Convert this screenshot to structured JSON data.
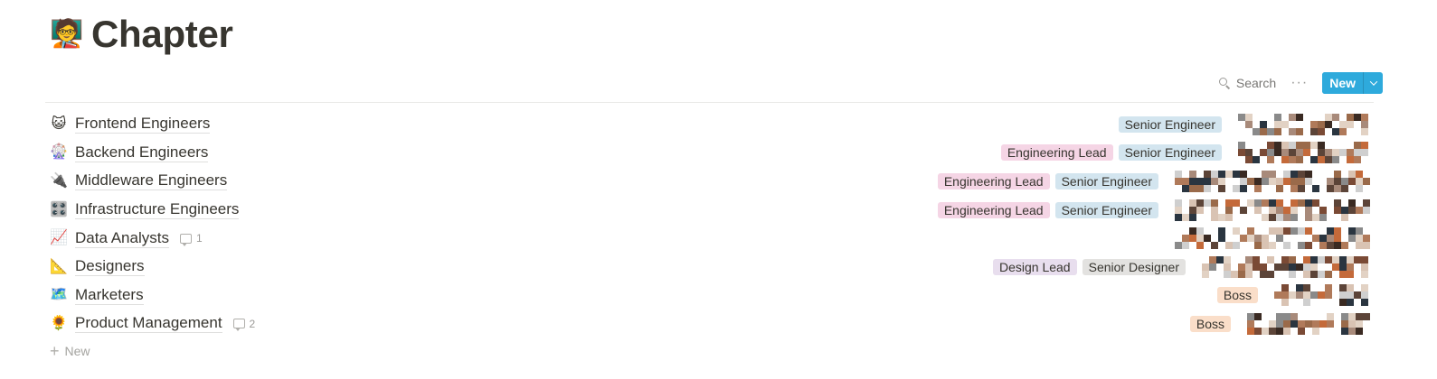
{
  "page": {
    "icon": "🧑‍🏫",
    "title": "Chapter"
  },
  "toolbar": {
    "search_label": "Search",
    "more_label": "···",
    "new_label": "New"
  },
  "colors": {
    "accent": "#2eaadc",
    "tag_pink": "#f5d5e5",
    "tag_blue": "#d3e5ef",
    "tag_purple": "#e8deee",
    "tag_gray": "#e3e2e0",
    "tag_orange": "#fadec9"
  },
  "rows": [
    {
      "icon": "😺",
      "title": "Frontend Engineers",
      "comments": "",
      "tags": [
        {
          "label": "Senior Engineer",
          "color": "blue"
        }
      ]
    },
    {
      "icon": "🎡",
      "title": "Backend Engineers",
      "comments": "",
      "tags": [
        {
          "label": "Engineering Lead",
          "color": "pink"
        },
        {
          "label": "Senior Engineer",
          "color": "blue"
        }
      ]
    },
    {
      "icon": "🔌",
      "title": "Middleware Engineers",
      "comments": "",
      "tags": [
        {
          "label": "Engineering Lead",
          "color": "pink"
        },
        {
          "label": "Senior Engineer",
          "color": "blue"
        }
      ]
    },
    {
      "icon": "🎛️",
      "title": "Infrastructure Engineers",
      "comments": "",
      "tags": [
        {
          "label": "Engineering Lead",
          "color": "pink"
        },
        {
          "label": "Senior Engineer",
          "color": "blue"
        }
      ]
    },
    {
      "icon": "📈",
      "title": "Data Analysts",
      "comments": "1",
      "tags": []
    },
    {
      "icon": "📐",
      "title": "Designers",
      "comments": "",
      "tags": [
        {
          "label": "Design Lead",
          "color": "purple"
        },
        {
          "label": "Senior Designer",
          "color": "gray"
        }
      ]
    },
    {
      "icon": "🗺️",
      "title": "Marketers",
      "comments": "",
      "tags": [
        {
          "label": "Boss",
          "color": "orange"
        }
      ]
    },
    {
      "icon": "🌻",
      "title": "Product Management",
      "comments": "2",
      "tags": [
        {
          "label": "Boss",
          "color": "orange"
        }
      ]
    }
  ],
  "add_row_label": "New"
}
